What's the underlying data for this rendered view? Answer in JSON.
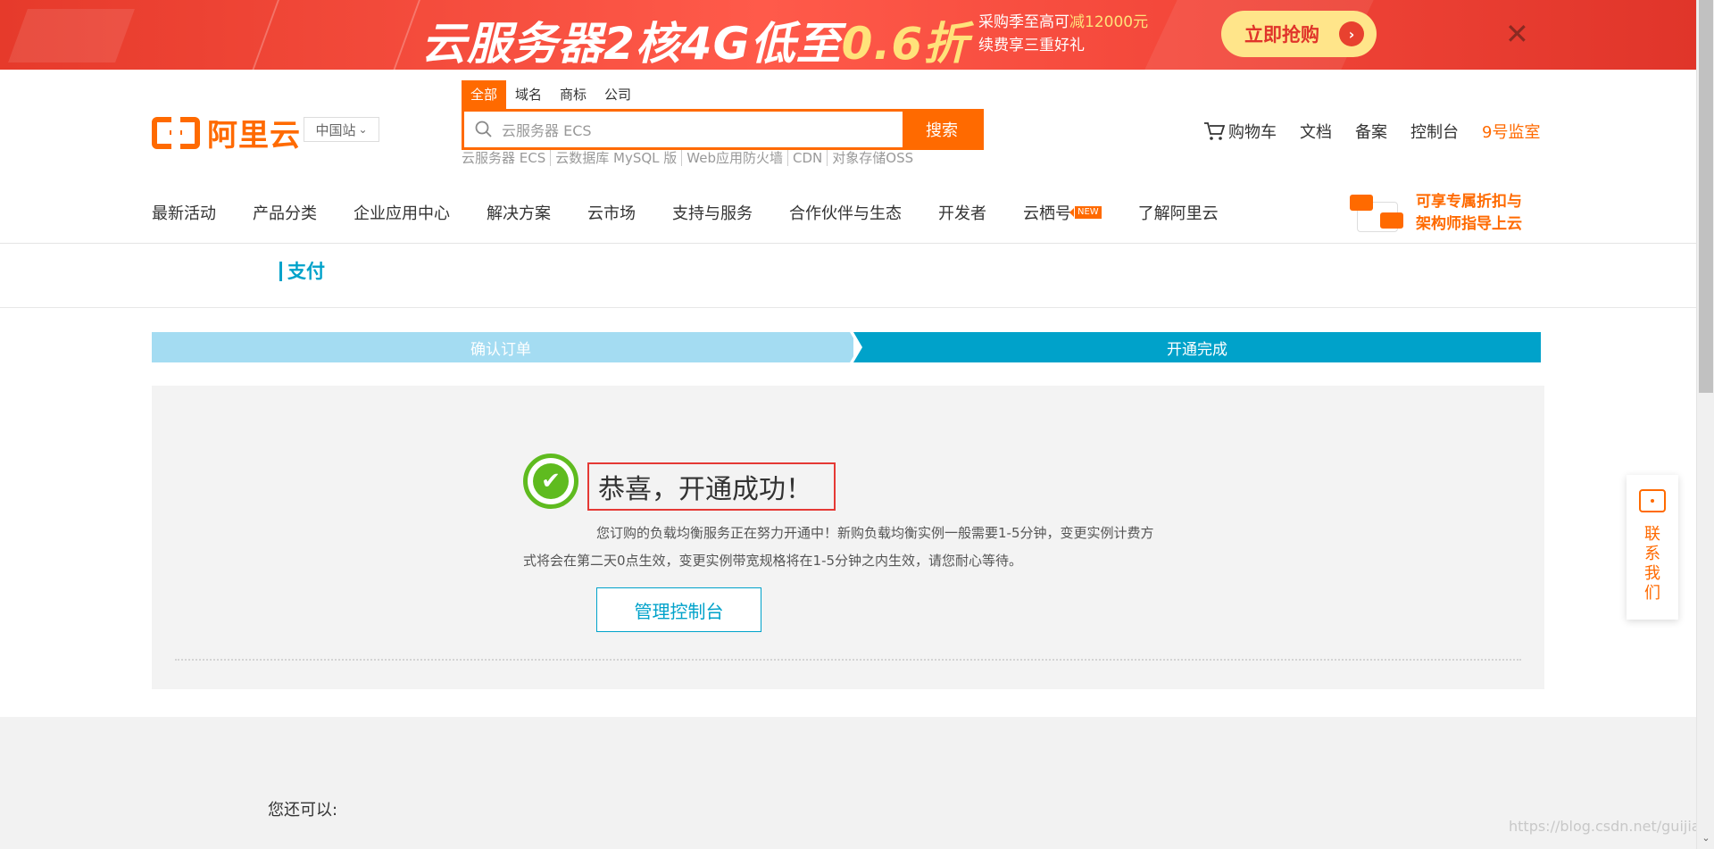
{
  "banner": {
    "title_main": "云服务器2核4G低至",
    "title_highlight": "0.6折",
    "sub_line1_prefix": "采购季至高可",
    "sub_line1_highlight": "减12000元",
    "sub_line2": "续费享三重好礼",
    "cta_label": "立即抢购",
    "cta_arrow": "›",
    "close_glyph": "✕"
  },
  "header": {
    "logo_text": "阿里云",
    "region_label": "中国站",
    "region_chevron": "⌄",
    "search": {
      "tabs": [
        "全部",
        "域名",
        "商标",
        "公司"
      ],
      "active_tab": "全部",
      "placeholder": "云服务器 ECS",
      "button_label": "搜索",
      "hot_links": [
        "云服务器 ECS",
        "云数据库 MySQL 版",
        "Web应用防火墙",
        "CDN",
        "对象存储OSS"
      ]
    },
    "top_links": {
      "cart": "购物车",
      "docs": "文档",
      "filing": "备案",
      "console": "控制台",
      "promo": "9号监室"
    }
  },
  "nav": {
    "items": [
      "最新活动",
      "产品分类",
      "企业应用中心",
      "解决方案",
      "云市场",
      "支持与服务",
      "合作伙伴与生态",
      "开发者",
      "云栖号",
      "了解阿里云"
    ],
    "new_badge": "NEW",
    "promo_line1": "可享专属折扣与",
    "promo_line2": "架构师指导上云"
  },
  "pay": {
    "title": "支付"
  },
  "steps": {
    "step1": "确认订单",
    "step2": "开通完成",
    "current": 2
  },
  "result": {
    "check_glyph": "✔",
    "title": "恭喜，开通成功！",
    "description": "您订购的负载均衡服务正在努力开通中！新购负载均衡实例一般需要1-5分钟，变更实例计费方式将会在第二天0点生效，变更实例带宽规格将在1-5分钟之内生效，请您耐心等待。",
    "console_button": "管理控制台"
  },
  "bottom": {
    "also_label": "您还可以:"
  },
  "contact": {
    "label": "联系我们"
  },
  "watermark": "https://blog.csdn.net/guijianchouxy",
  "scrollbar": {
    "arrow_glyph": "⌄"
  },
  "colors": {
    "brand_orange": "#ff6a00",
    "accent_blue": "#00a2ca",
    "success_green": "#5fbb1f",
    "highlight_red": "#e53935"
  }
}
